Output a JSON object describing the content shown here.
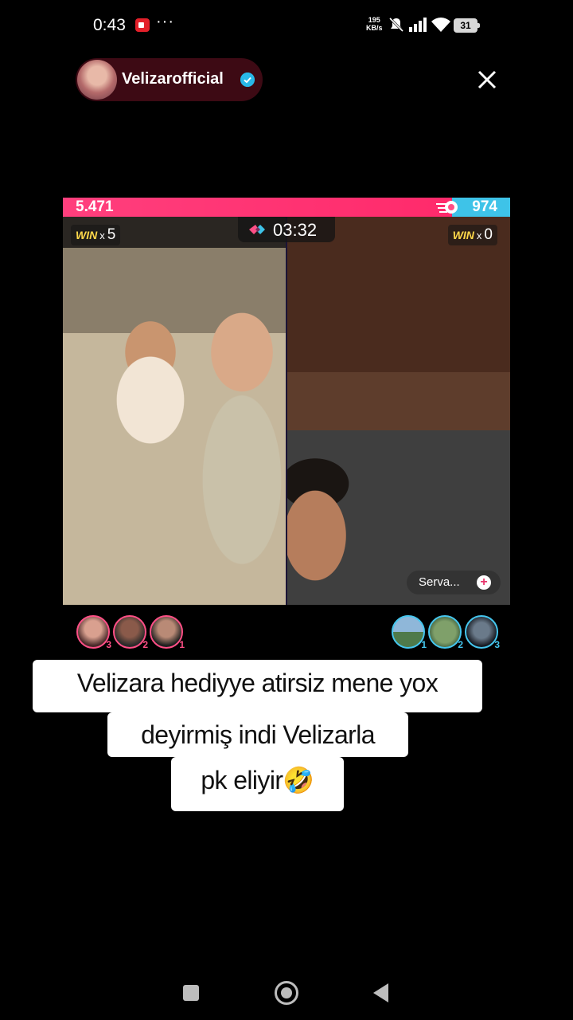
{
  "status_bar": {
    "time": "0:43",
    "dots": "···",
    "speed_value": "195",
    "speed_unit": "KB/s",
    "battery": "31"
  },
  "host": {
    "name": "Velizarofficial"
  },
  "battle": {
    "score_left": "5.471",
    "score_right": "974",
    "score_left_fraction": 0.87,
    "timer": "03:32",
    "left_win_word": "WIN",
    "left_win_x": "x",
    "left_win_count": "5",
    "right_win_word": "WIN",
    "right_win_x": "x",
    "right_win_count": "0",
    "guest_name": "Serva...",
    "guest_plus": "+"
  },
  "supporters": {
    "left": [
      {
        "rank": "3"
      },
      {
        "rank": "2"
      },
      {
        "rank": "1"
      }
    ],
    "right": [
      {
        "rank": "1"
      },
      {
        "rank": "2"
      },
      {
        "rank": "3"
      }
    ]
  },
  "caption": {
    "line1": "Velizara hediyye atirsiz mene yox",
    "line2": "deyirmiş indi Velizarla",
    "line3": "pk eliyir🤣"
  },
  "colors": {
    "left_team": "#ff2a6b",
    "right_team": "#3ec3e8",
    "win_gold": "#ffd84a"
  }
}
